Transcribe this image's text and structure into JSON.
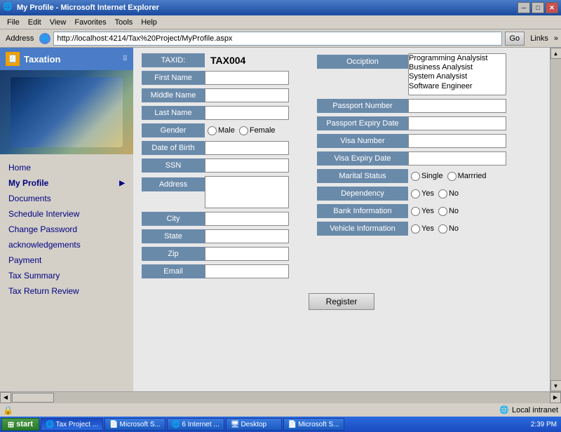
{
  "titlebar": {
    "title": "My Profile - Microsoft Internet Explorer",
    "min": "─",
    "max": "□",
    "close": "✕"
  },
  "menubar": {
    "items": [
      "File",
      "Edit",
      "View",
      "Favorites",
      "Tools",
      "Help"
    ]
  },
  "addressbar": {
    "label": "Address",
    "url": "http://localhost:4214/Tax%20Project/MyProfile.aspx",
    "go": "Go",
    "links": "Links"
  },
  "sidebar": {
    "header": "Taxation",
    "nav": [
      {
        "label": "Home",
        "arrow": false
      },
      {
        "label": "My Profile",
        "arrow": true
      },
      {
        "label": "Documents",
        "arrow": false
      },
      {
        "label": "Schedule Interview",
        "arrow": false
      },
      {
        "label": "Change Password",
        "arrow": false
      },
      {
        "label": "acknowledgements",
        "arrow": false
      },
      {
        "label": "Payment",
        "arrow": false
      },
      {
        "label": "Tax Summary",
        "arrow": false
      },
      {
        "label": "Tax Return Review",
        "arrow": false
      }
    ]
  },
  "form": {
    "taxid_label": "TAXID:",
    "taxid_value": "TAX004",
    "first_name_label": "First Name",
    "middle_name_label": "Middle Name",
    "last_name_label": "Last Name",
    "gender_label": "Gender",
    "gender_male": "Male",
    "gender_female": "Female",
    "dob_label": "Date of Birth",
    "ssn_label": "SSN",
    "address_label": "Address",
    "city_label": "City",
    "state_label": "State",
    "zip_label": "Zip",
    "email_label": "Email",
    "occupation_label": "Occiption",
    "occupation_options": [
      "Programming Analysist",
      "Business Analysist",
      "System Analysist",
      "Software Engineer"
    ],
    "passport_label": "Passport Number",
    "passport_expiry_label": "Passport Expiry Date",
    "visa_label": "Visa Number",
    "visa_expiry_label": "Visa Expiry Date",
    "marital_label": "Marital Status",
    "marital_single": "Single",
    "marital_married": "Marrried",
    "dependency_label": "Dependency",
    "dependency_yes": "Yes",
    "dependency_no": "No",
    "bank_label": "Bank Information",
    "bank_yes": "Yes",
    "bank_no": "No",
    "vehicle_label": "Vehicle Information",
    "vehicle_yes": "Yes",
    "vehicle_no": "No",
    "register_btn": "Register"
  },
  "statusbar": {
    "text": "",
    "right": "Local intranet"
  },
  "taskbar": {
    "start": "start",
    "items": [
      {
        "label": "Tax Project ...",
        "active": true
      },
      {
        "label": "Microsoft S..."
      },
      {
        "label": "6 Internet ..."
      },
      {
        "label": "Desktop"
      },
      {
        "label": "Microsoft S..."
      }
    ],
    "time": "2:39 PM"
  }
}
